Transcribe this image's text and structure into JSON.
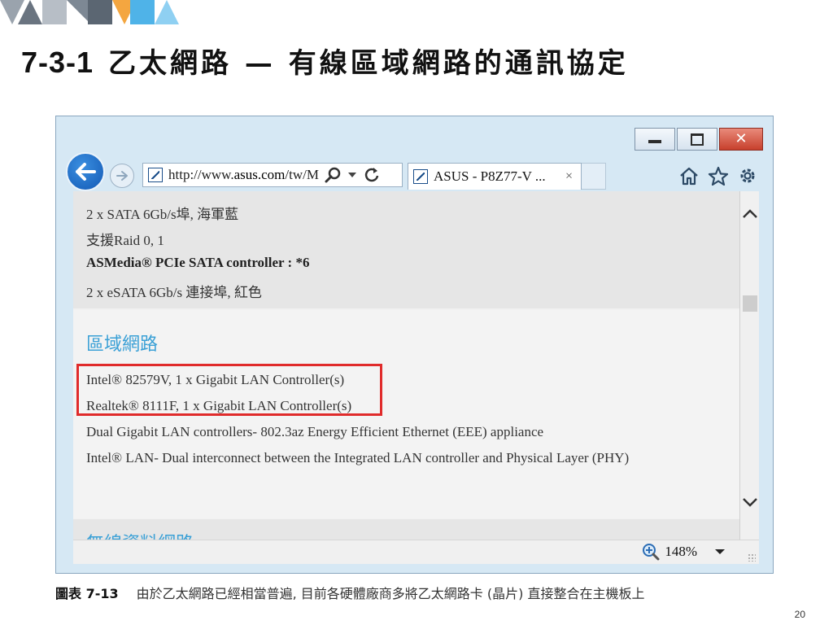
{
  "slide": {
    "title_number": "7-3-1",
    "title_text": "乙太網路 — 有線區域網路的通訊協定",
    "caption_label": "圖表 7-13",
    "caption_text": "由於乙太網路已經相當普遍, 目前各硬體廠商多將乙太網路卡 (晶片) 直接整合在主機板上",
    "page_number": "20"
  },
  "browser": {
    "address_prefix": "http://www.",
    "address_domain": "asus.com",
    "address_suffix": "/tw/M",
    "tab_title": "ASUS - P8Z77-V ...",
    "tab_close": "×",
    "zoom_level": "148%"
  },
  "content": {
    "storage_lines": [
      "2 x SATA 6Gb/s埠, 海軍藍",
      "支援Raid 0, 1",
      "ASMedia® PCIe SATA controller : *6",
      "2 x eSATA 6Gb/s 連接埠, 紅色"
    ],
    "lan_heading": "區域網路",
    "lan_lines": [
      "Intel® 82579V, 1 x Gigabit LAN Controller(s)",
      "Realtek® 8111F, 1 x Gigabit LAN Controller(s)",
      "Dual Gigabit LAN controllers- 802.3az Energy Efficient Ethernet (EEE) appliance",
      "Intel® LAN- Dual interconnect between the Integrated LAN controller and Physical Layer (PHY)"
    ],
    "wireless_heading": "無線資料網路"
  },
  "colors": {
    "heading_blue": "#3aa0d6",
    "highlight_red": "#e02b2b",
    "window_frame": "#d6e8f4"
  }
}
